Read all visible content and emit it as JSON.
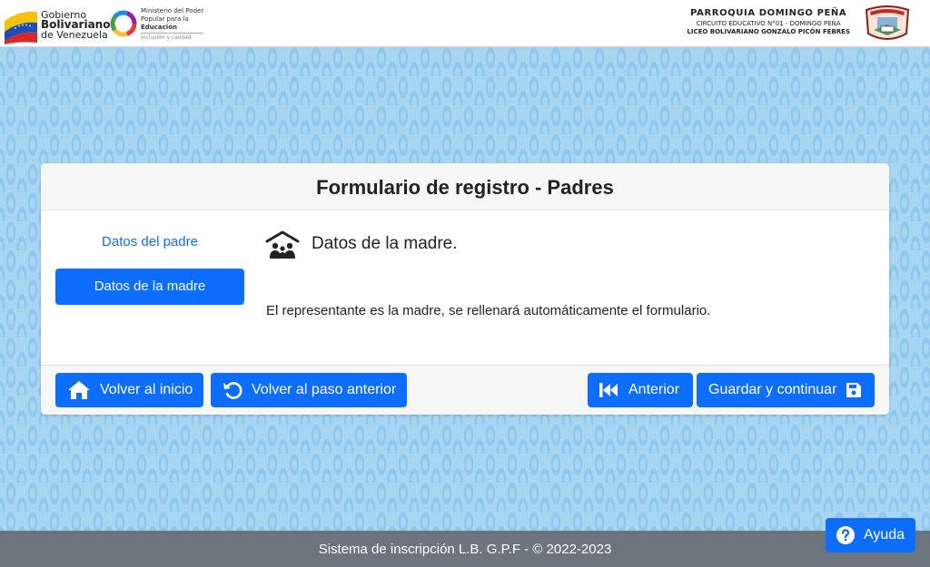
{
  "header": {
    "gov_logo": {
      "line1": "Gobierno",
      "line2": "Bolivariano",
      "line3": "de Venezuela"
    },
    "ministry_logo": {
      "line1": "Ministerio del Poder",
      "line2": "Popular para la",
      "line3": "Educación",
      "tagline": "Inclusión y calidad"
    },
    "school": {
      "parish": "PARROQUIA DOMINGO PEÑA",
      "circuit": "CIRCUITO EDUCATIVO N°01 - DOMINGO PEÑA",
      "name": "LICEO BOLIVARIANO GONZALO PICÓN FEBRES"
    }
  },
  "form": {
    "title": "Formulario de registro - Padres",
    "nav": {
      "father_label": "Datos del padre",
      "mother_label": "Datos de la madre"
    },
    "section": {
      "icon": "family-house-icon",
      "title": "Datos de la madre.",
      "note": "El representante es la madre, se rellenará automáticamente el formulario."
    },
    "buttons": {
      "home": "Volver al inicio",
      "back_step": "Volver al paso anterior",
      "previous": "Anterior",
      "save_continue": "Guardar y continuar"
    }
  },
  "footer": {
    "text": "Sistema de inscripción L.B. G.P.F - © 2022-2023",
    "help_label": "Ayuda"
  },
  "colors": {
    "primary": "#0d6efd",
    "footer_bg": "#6c757d",
    "page_bg": "#a8d5f1"
  }
}
